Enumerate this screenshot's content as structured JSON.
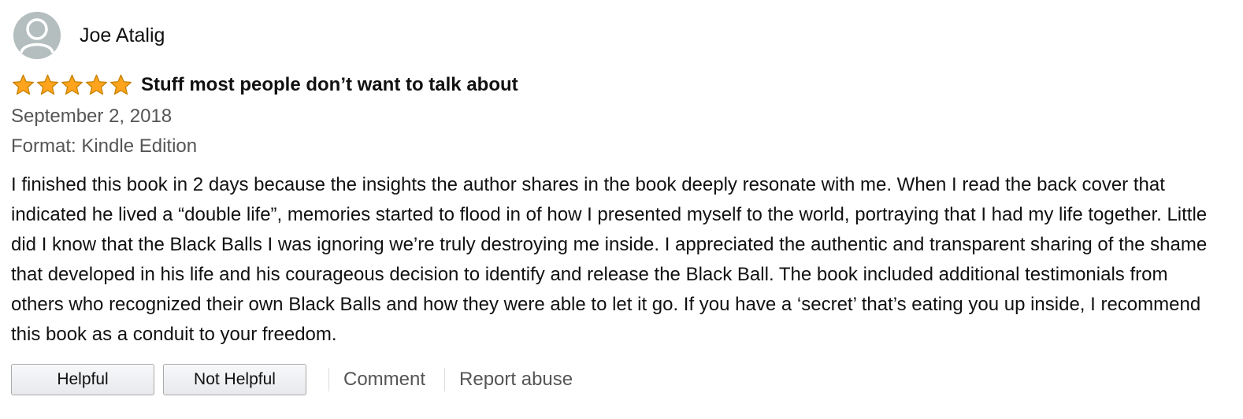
{
  "profile": {
    "name": "Joe Atalig",
    "avatar_icon": "default-user-silhouette-icon"
  },
  "review": {
    "rating": 5,
    "rating_max": 5,
    "star_color": "#ffa41c",
    "title": "Stuff most people don’t want to talk about",
    "date": "September 2, 2018",
    "format": "Format: Kindle Edition",
    "body": "I finished this book in 2 days because the insights the author shares in the book deeply resonate with me. When I read the back cover that indicated he lived a “double life”, memories started to flood in of how I presented myself to the world, portraying that I had my life together. Little did I know that the Black Balls I was ignoring we’re truly destroying me inside. I appreciated the authentic and transparent sharing of the shame that developed in his life and his courageous decision to identify and release the Black Ball. The book included additional testimonials from others who recognized their own Black Balls and how they were able to let it go. If you have a ‘secret’ that’s eating you up inside, I recommend this book as a conduit to your freedom."
  },
  "actions": {
    "helpful_label": "Helpful",
    "not_helpful_label": "Not Helpful",
    "comment_label": "Comment",
    "report_label": "Report abuse"
  }
}
